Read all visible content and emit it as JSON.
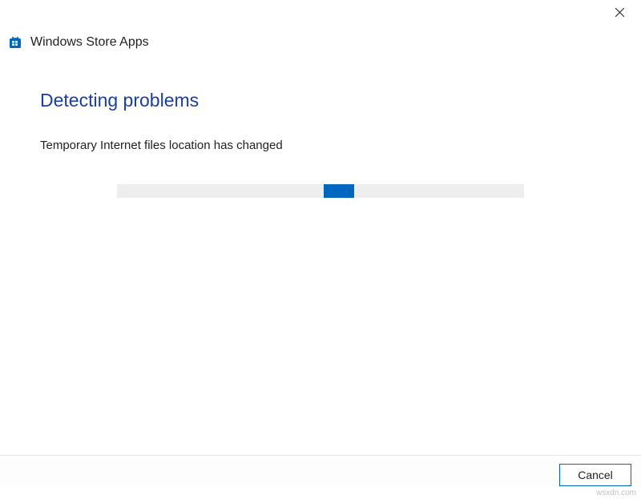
{
  "window": {
    "app_title": "Windows Store Apps"
  },
  "content": {
    "heading": "Detecting problems",
    "status": "Temporary Internet files location has changed",
    "progress": {
      "indicator_left_pct": 50.7
    }
  },
  "footer": {
    "cancel_label": "Cancel"
  },
  "colors": {
    "accent": "#0067c0",
    "heading": "#1a3ea8",
    "progress_track": "#eeeeee"
  },
  "watermark": "wsxdn.com"
}
